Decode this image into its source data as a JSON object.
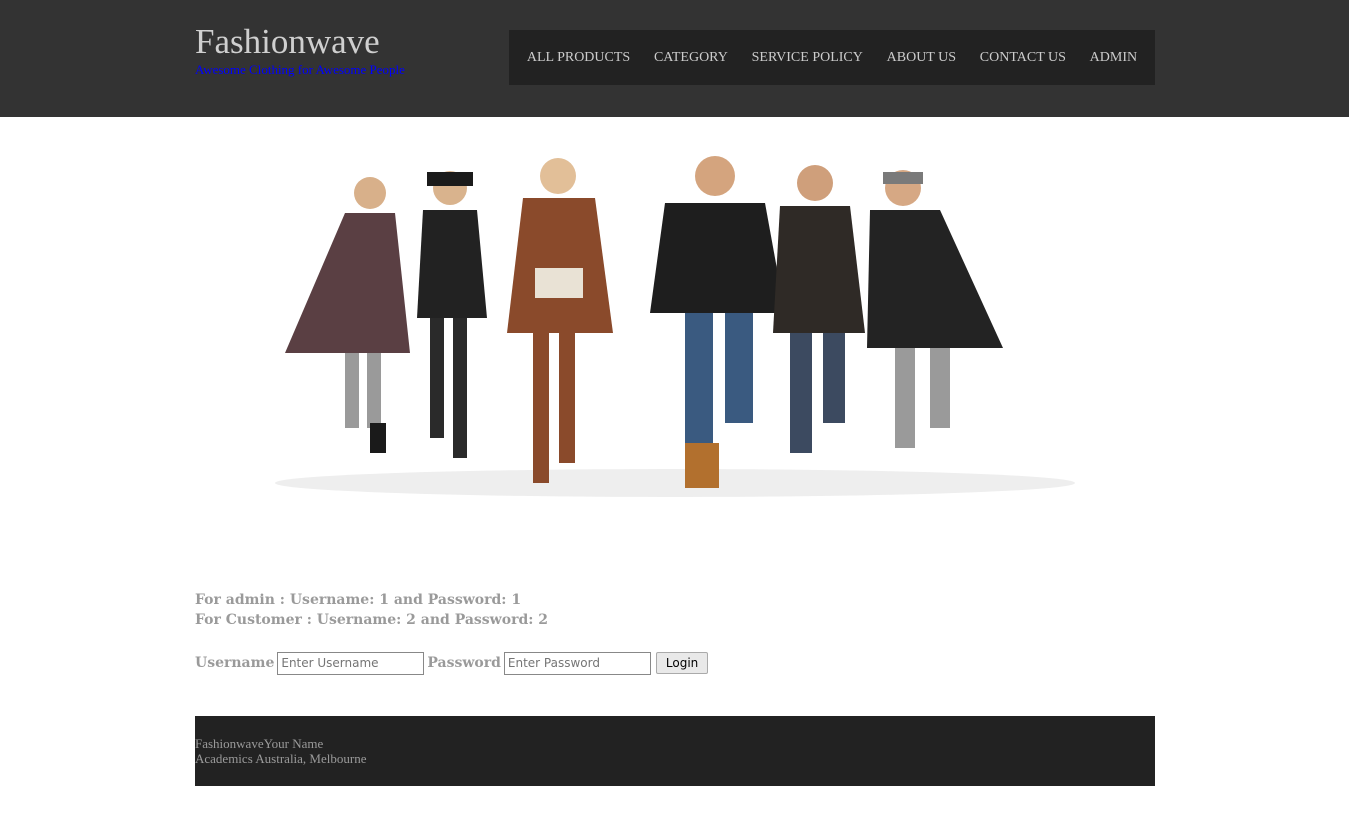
{
  "site": {
    "title": "Fashionwave",
    "tagline": "Awesome Clothing for Awesome People",
    "tagline_color": "#0000ff"
  },
  "nav": {
    "items": [
      "ALL PRODUCTS",
      "CATEGORY",
      "SERVICE POLICY",
      "ABOUT US",
      "CONTACT US",
      "ADMIN"
    ]
  },
  "hero": {
    "icon": "fashion-models-banner-image"
  },
  "credentials": {
    "admin_line": "For admin : Username: 1 and Password: 1",
    "customer_line": "For Customer : Username: 2 and Password: 2"
  },
  "login": {
    "username_label": "Username",
    "username_placeholder": "Enter Username",
    "password_label": "Password",
    "password_placeholder": "Enter Password",
    "button_label": "Login"
  },
  "footer": {
    "line1": "FashionwaveYour Name",
    "line2": "Academics Australia, Melbourne"
  }
}
